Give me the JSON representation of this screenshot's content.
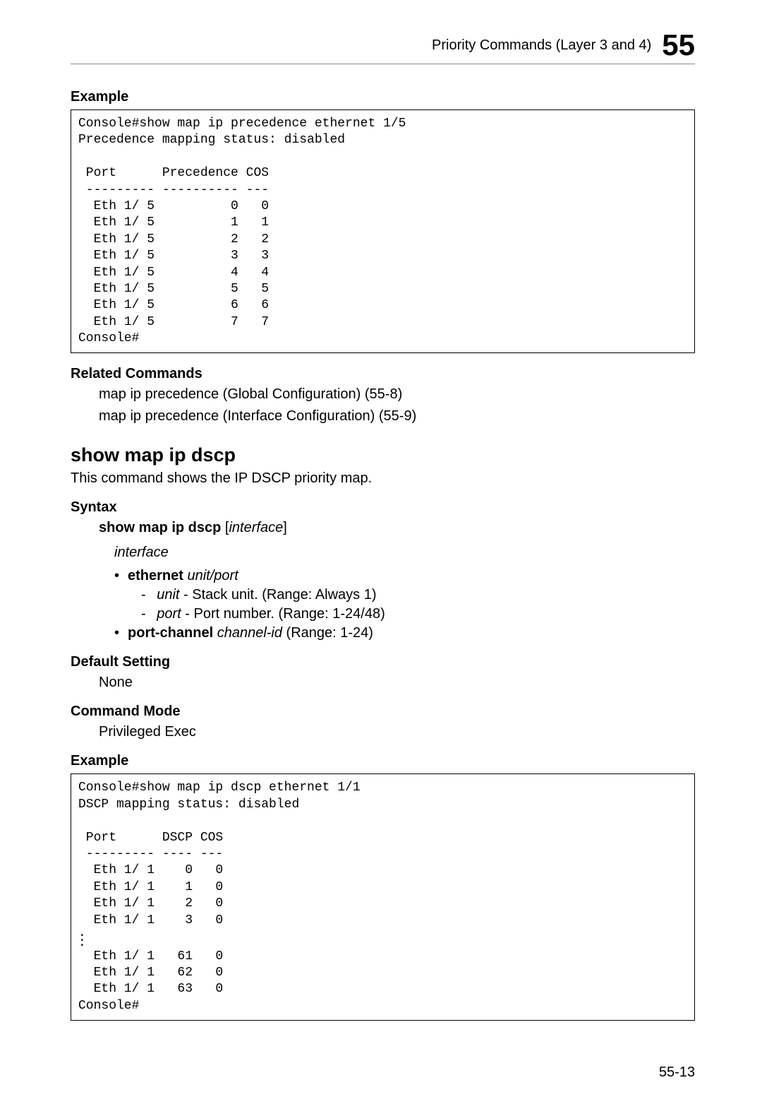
{
  "header": {
    "title": "Priority Commands (Layer 3 and 4)",
    "chapter": "55"
  },
  "example1": {
    "heading": "Example",
    "code": "Console#show map ip precedence ethernet 1/5\nPrecedence mapping status: disabled\n\n Port      Precedence COS\n --------- ---------- ---\n  Eth 1/ 5          0   0\n  Eth 1/ 5          1   1\n  Eth 1/ 5          2   2\n  Eth 1/ 5          3   3\n  Eth 1/ 5          4   4\n  Eth 1/ 5          5   5\n  Eth 1/ 5          6   6\n  Eth 1/ 5          7   7\nConsole#"
  },
  "related_commands": {
    "heading": "Related Commands",
    "line1": "map ip precedence (Global Configuration) (55-8)",
    "line2": "map ip precedence (Interface Configuration) (55-9)"
  },
  "command": {
    "name": "show map ip dscp",
    "description": "This command shows the IP DSCP priority map."
  },
  "syntax": {
    "heading": "Syntax",
    "command_bold": "show map ip dscp",
    "command_italic": "interface",
    "param_interface": "interface",
    "ethernet_bold": "ethernet",
    "ethernet_italic": "unit/port",
    "unit_label": "unit",
    "unit_desc": " - Stack unit. (Range: Always 1)",
    "port_label": "port",
    "port_desc": " - Port number. (Range: 1-24/48)",
    "portchannel_bold": "port-channel",
    "portchannel_italic": "channel-id",
    "portchannel_rest": " (Range: 1-24)"
  },
  "default_setting": {
    "heading": "Default Setting",
    "value": "None"
  },
  "command_mode": {
    "heading": "Command Mode",
    "value": "Privileged Exec"
  },
  "example2": {
    "heading": "Example",
    "code_top": "Console#show map ip dscp ethernet 1/1\nDSCP mapping status: disabled\n\n Port      DSCP COS\n --------- ---- ---\n  Eth 1/ 1    0   0\n  Eth 1/ 1    1   0\n  Eth 1/ 1    2   0\n  Eth 1/ 1    3   0",
    "code_bottom": "  Eth 1/ 1   61   0\n  Eth 1/ 1   62   0\n  Eth 1/ 1   63   0\nConsole#"
  },
  "page_number": "55-13"
}
